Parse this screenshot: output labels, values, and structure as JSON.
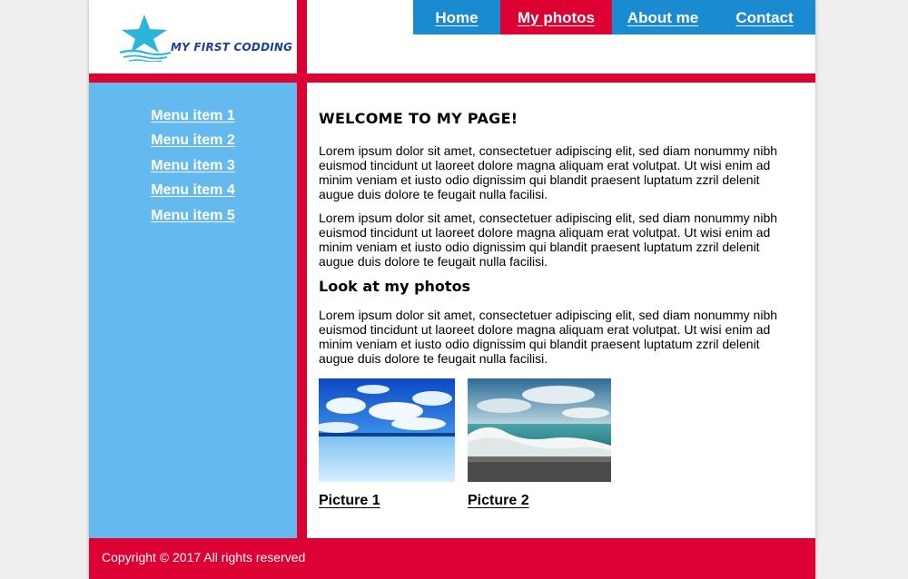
{
  "brand": {
    "logo_text": "MY FIRST CODDING"
  },
  "nav": {
    "items": [
      {
        "label": "Home"
      },
      {
        "label": "My photos"
      },
      {
        "label": "About me"
      },
      {
        "label": "Contact"
      }
    ],
    "active": "My photos"
  },
  "sidebar": {
    "items": [
      {
        "label": "Menu item 1"
      },
      {
        "label": "Menu item 2"
      },
      {
        "label": "Menu item 3"
      },
      {
        "label": "Menu item 4"
      },
      {
        "label": "Menu item 5"
      }
    ]
  },
  "main": {
    "title": "WELCOME TO MY PAGE!",
    "para1": "Lorem ipsum dolor sit amet, consectetuer adipiscing elit, sed diam nonummy nibh euismod tincidunt ut laoreet dolore magna aliquam erat volutpat. Ut wisi enim ad minim veniam et iusto odio dignissim qui blandit praesent luptatum zzril delenit augue duis dolore te feugait nulla facilisi.",
    "para2": "Lorem ipsum dolor sit amet, consectetuer adipiscing elit, sed diam nonummy nibh euismod tincidunt ut laoreet dolore magna aliquam erat volutpat. Ut wisi enim ad minim veniam et iusto odio dignissim qui blandit praesent luptatum zzril delenit augue duis dolore te feugait nulla facilisi.",
    "subtitle": "Look at my photos",
    "para3": "Lorem ipsum dolor sit amet, consectetuer adipiscing elit, sed diam nonummy nibh euismod tincidunt ut laoreet dolore magna aliquam erat volutpat. Ut wisi enim ad minim veniam et iusto odio dignissim qui blandit praesent luptatum zzril delenit augue duis dolore te feugait nulla facilisi.",
    "photos": [
      {
        "caption": "Picture 1"
      },
      {
        "caption": "Picture 2"
      }
    ]
  },
  "footer": {
    "text": "Copyright © 2017 All rights reserved"
  },
  "colors": {
    "accent_red": "#dc0033",
    "nav_blue": "#1b8bd1",
    "sidebar_blue": "#64baee",
    "logo_teal": "#2bb5d9",
    "logo_text": "#1d3f94"
  },
  "icons": {
    "logo": "starfish-logo-icon"
  }
}
